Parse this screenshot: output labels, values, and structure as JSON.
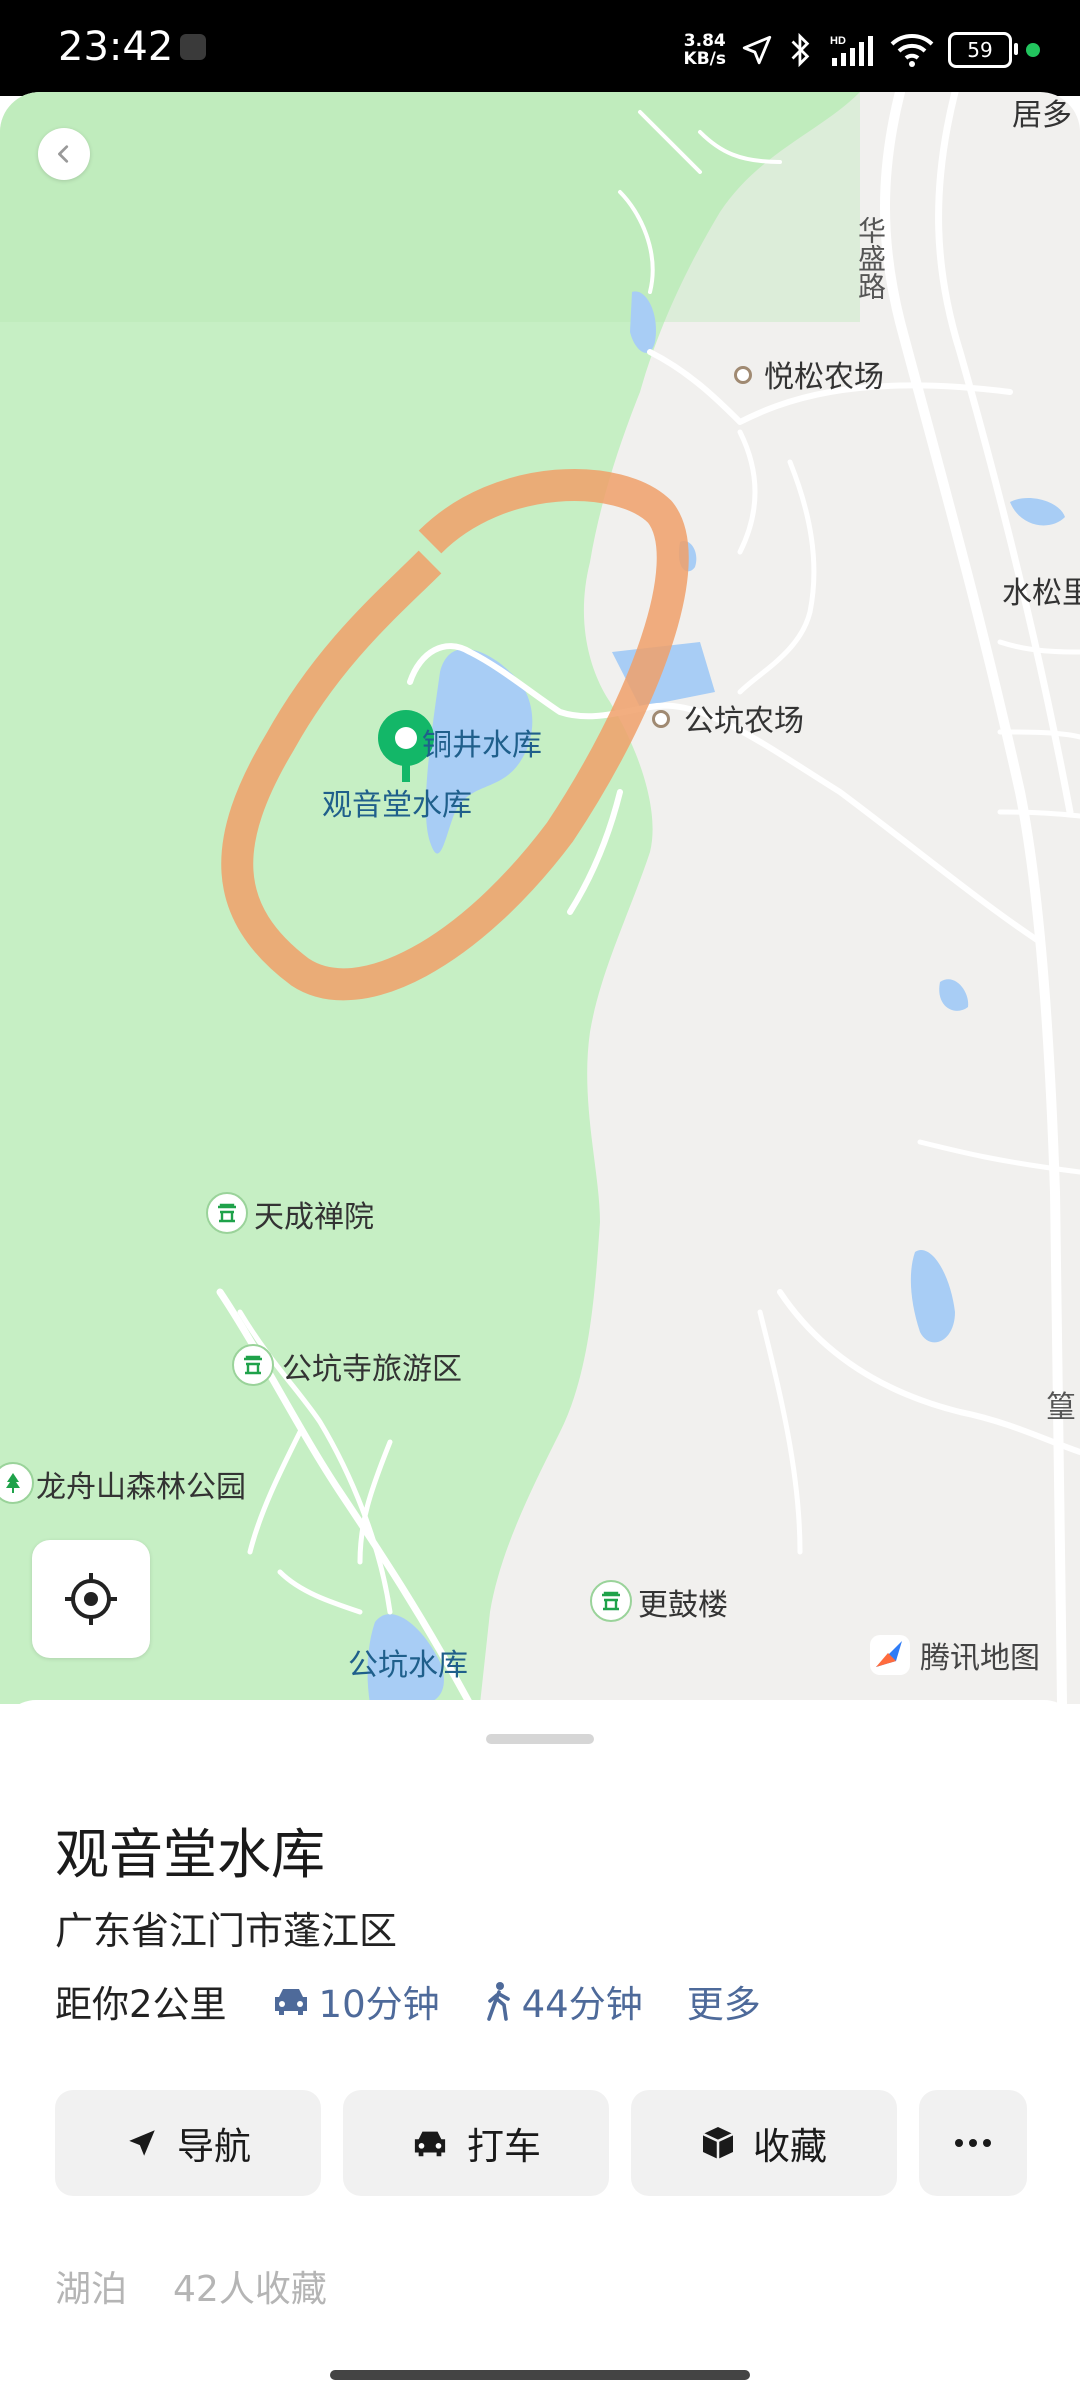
{
  "status_bar": {
    "time": "23:42",
    "net_speed_value": "3.84",
    "net_speed_unit": "KB/s",
    "battery": "59",
    "icons": [
      "location-arrow-icon",
      "bluetooth-icon",
      "hd-signal-icon",
      "wifi-icon",
      "battery-icon"
    ]
  },
  "map": {
    "labels": {
      "huasheng_road": "华盛路",
      "yuesong_farm": "悦松农场",
      "shuisong": "水松里",
      "gongkeng_farm": "公坑农场",
      "tongjing_reservoir": "铜井水库",
      "guanyintang_reservoir": "观音堂水库",
      "tiancheng_temple": "天成禅院",
      "gongkeng_temple_area": "公坑寺旅游区",
      "longzhoushan_park": "龙舟山森林公园",
      "gengulou": "更鼓楼",
      "gongkeng_reservoir": "公坑水库",
      "top_right_partial": "居多",
      "right_partial": "篁"
    },
    "logo_text": "腾讯地图",
    "colors": {
      "forest": "#c8f0c6",
      "land": "#f1f0ee",
      "water": "#a8cdf5",
      "road": "#ffffff",
      "marker": "#13b768",
      "highlight": "#f0a06a"
    }
  },
  "place": {
    "name": "观音堂水库",
    "address": "广东省江门市蓬江区",
    "distance": "距你2公里",
    "drive_time": "10分钟",
    "walk_time": "44分钟",
    "more": "更多"
  },
  "actions": {
    "navigate": "导航",
    "taxi": "打车",
    "favorite": "收藏",
    "more_icon": "ellipsis-icon"
  },
  "tags": {
    "category": "湖泊",
    "favorites": "42人收藏"
  }
}
